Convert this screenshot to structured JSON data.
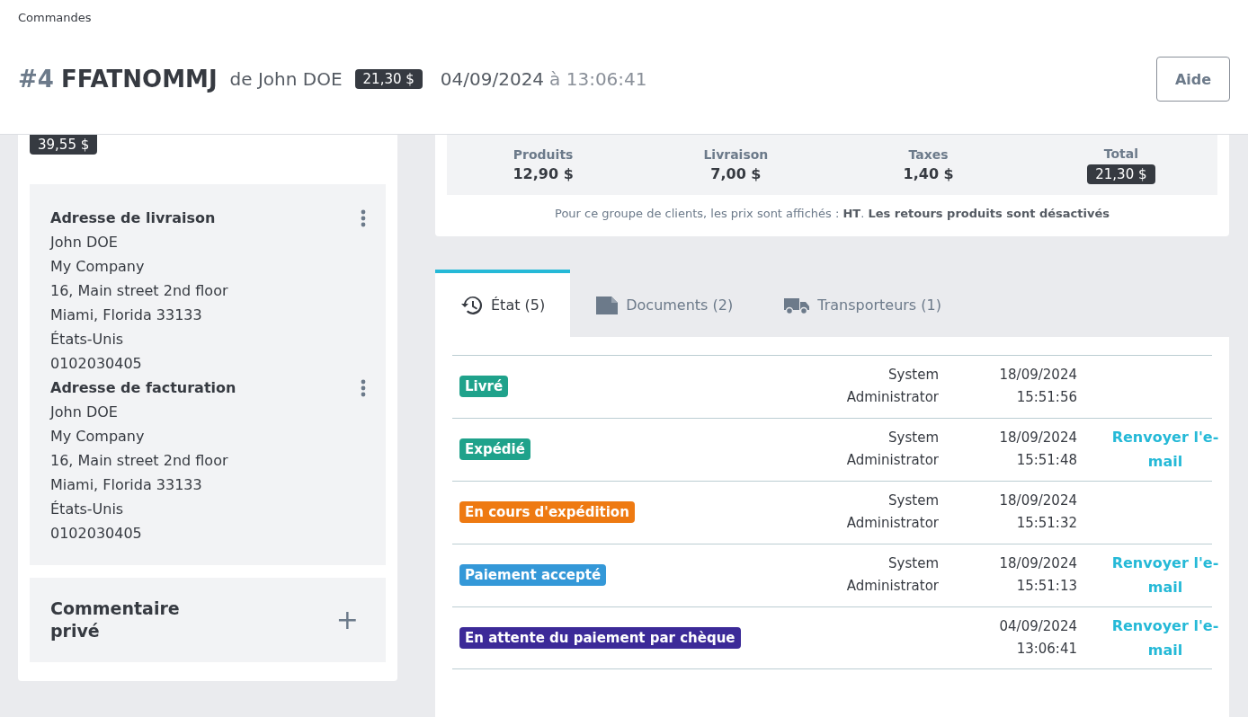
{
  "breadcrumb": "Commandes",
  "order": {
    "number": "#4",
    "reference": "FFATNOMMJ",
    "customer": "de John DOE",
    "total_badge": "21,30 $",
    "date": "04/09/2024",
    "at": "à 13:06:41"
  },
  "help_button": "Aide",
  "customer_card": {
    "spent_badge": "39,55 $",
    "addresses": [
      {
        "title": "Adresse de livraison",
        "lines": [
          "John DOE",
          "My Company",
          "16, Main street 2nd floor",
          "Miami, Florida 33133",
          "États-Unis",
          "0102030405"
        ]
      },
      {
        "title": "Adresse de facturation",
        "lines": [
          "John DOE",
          "My Company",
          "16, Main street 2nd floor",
          "Miami, Florida 33133",
          "États-Unis",
          "0102030405"
        ]
      }
    ],
    "comment": {
      "title": "Commentaire privé",
      "add": "+"
    }
  },
  "summary": {
    "columns": [
      {
        "label": "Produits",
        "value": "12,90 $",
        "kind": "plain"
      },
      {
        "label": "Livraison",
        "value": "7,00 $",
        "kind": "plain"
      },
      {
        "label": "Taxes",
        "value": "1,40 $",
        "kind": "plain"
      },
      {
        "label": "Total",
        "value": "21,30 $",
        "kind": "badge"
      }
    ],
    "note": "Pour ce groupe de clients, les prix sont affichés : **HT**. **Les retours produits sont désactivés**"
  },
  "tabs": [
    {
      "label": "État (5)",
      "kind": "history",
      "selected": true
    },
    {
      "label": "Documents (2)",
      "kind": "document",
      "selected": false
    },
    {
      "label": "Transporteurs (1)",
      "kind": "truck",
      "selected": false
    }
  ],
  "history": [
    {
      "status": "Livré",
      "color": "#1fa28b",
      "user": [
        "System",
        "Administrator"
      ],
      "date": "18/09/2024",
      "time": "15:51:56"
    },
    {
      "status": "Expédié",
      "color": "#1fa28b",
      "user": [
        "System",
        "Administrator"
      ],
      "date": "18/09/2024",
      "time": "15:51:48",
      "resend": "Renvoyer l'e-mail"
    },
    {
      "status": "En cours d'expédition",
      "color": "#ee7a12",
      "user": [
        "System",
        "Administrator"
      ],
      "date": "18/09/2024",
      "time": "15:51:32"
    },
    {
      "status": "Paiement accepté",
      "color": "#3498d8",
      "user": [
        "System",
        "Administrator"
      ],
      "date": "18/09/2024",
      "time": "15:51:13",
      "resend": "Renvoyer l'e-mail"
    },
    {
      "status": "En attente du paiement par chèque",
      "color": "#3c2a98",
      "date": "04/09/2024",
      "time": "13:06:41",
      "resend": "Renvoyer l'e-mail"
    }
  ]
}
